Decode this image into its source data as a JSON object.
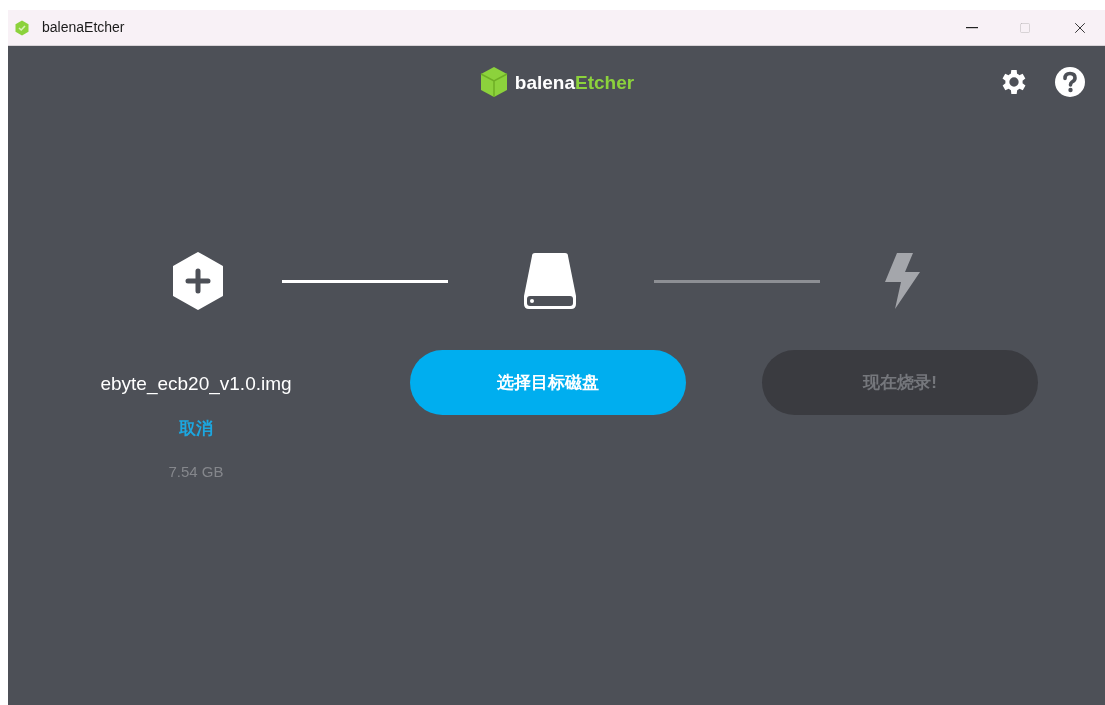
{
  "window": {
    "title": "balenaEtcher"
  },
  "header": {
    "brand_part_1": "balena",
    "brand_part_2": "Etcher"
  },
  "steps": [
    {
      "kind": "image",
      "active": true,
      "filename": "ebyte_ecb20_v1.0.img",
      "cancel_link": "取消",
      "size": "7.54 GB"
    },
    {
      "kind": "drive",
      "active": true,
      "button": "选择目标磁盘",
      "disabled": false
    },
    {
      "kind": "flash",
      "active": false,
      "button": "现在烧录!",
      "disabled": true
    }
  ],
  "connectors": [
    {
      "active": true
    },
    {
      "active": false
    }
  ]
}
